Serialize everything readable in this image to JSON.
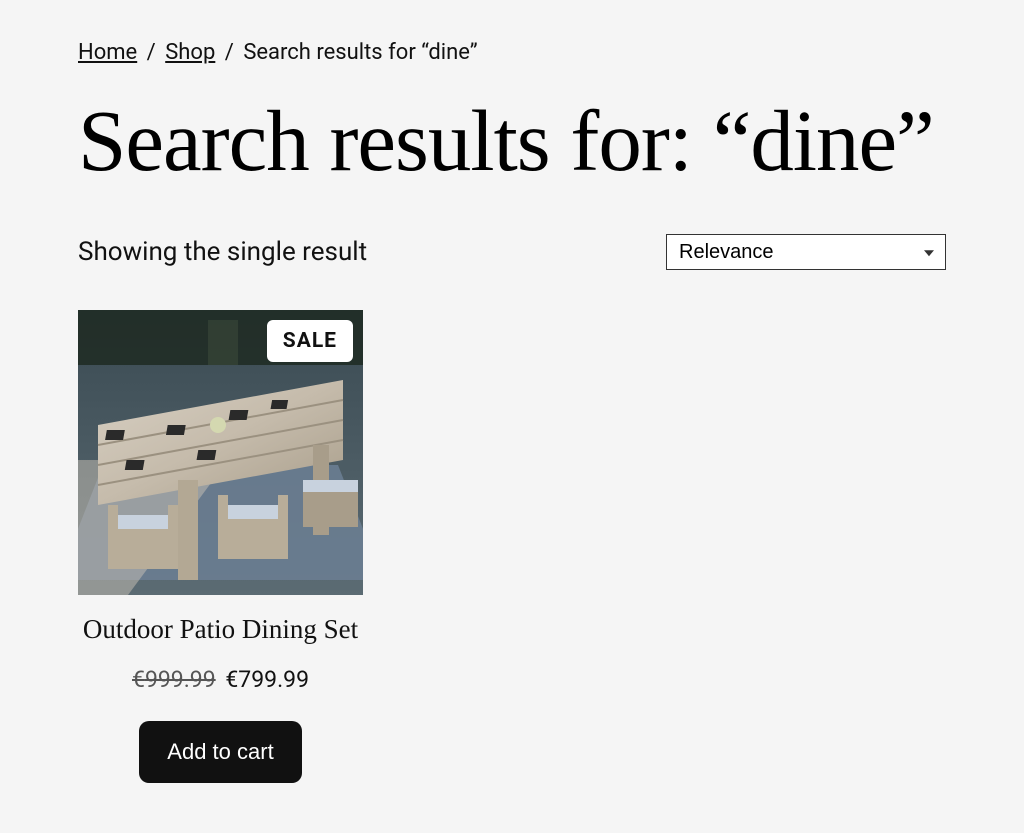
{
  "breadcrumb": {
    "home": "Home",
    "shop": "Shop",
    "current": "Search results for “dine”",
    "separator": "/"
  },
  "page_title": "Search results for: “dine”",
  "result_count": "Showing the single result",
  "sort": {
    "selected": "Relevance"
  },
  "product": {
    "sale_badge": "SALE",
    "title": "Outdoor Patio Dining Set",
    "currency": "€",
    "original_price": "999.99",
    "sale_price": "799.99",
    "add_to_cart": "Add to cart"
  }
}
